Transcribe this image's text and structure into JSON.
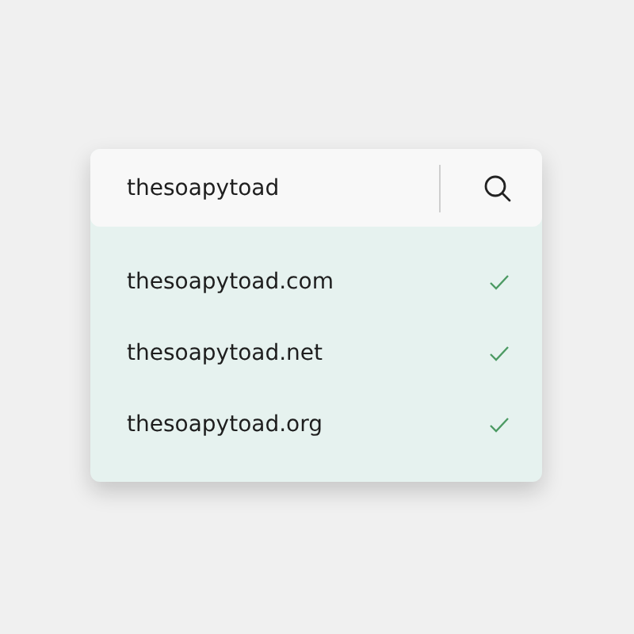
{
  "search": {
    "value": "thesoapytoad"
  },
  "results": [
    {
      "domain": "thesoapytoad.com",
      "available": true
    },
    {
      "domain": "thesoapytoad.net",
      "available": true
    },
    {
      "domain": "thesoapytoad.org",
      "available": true
    }
  ]
}
